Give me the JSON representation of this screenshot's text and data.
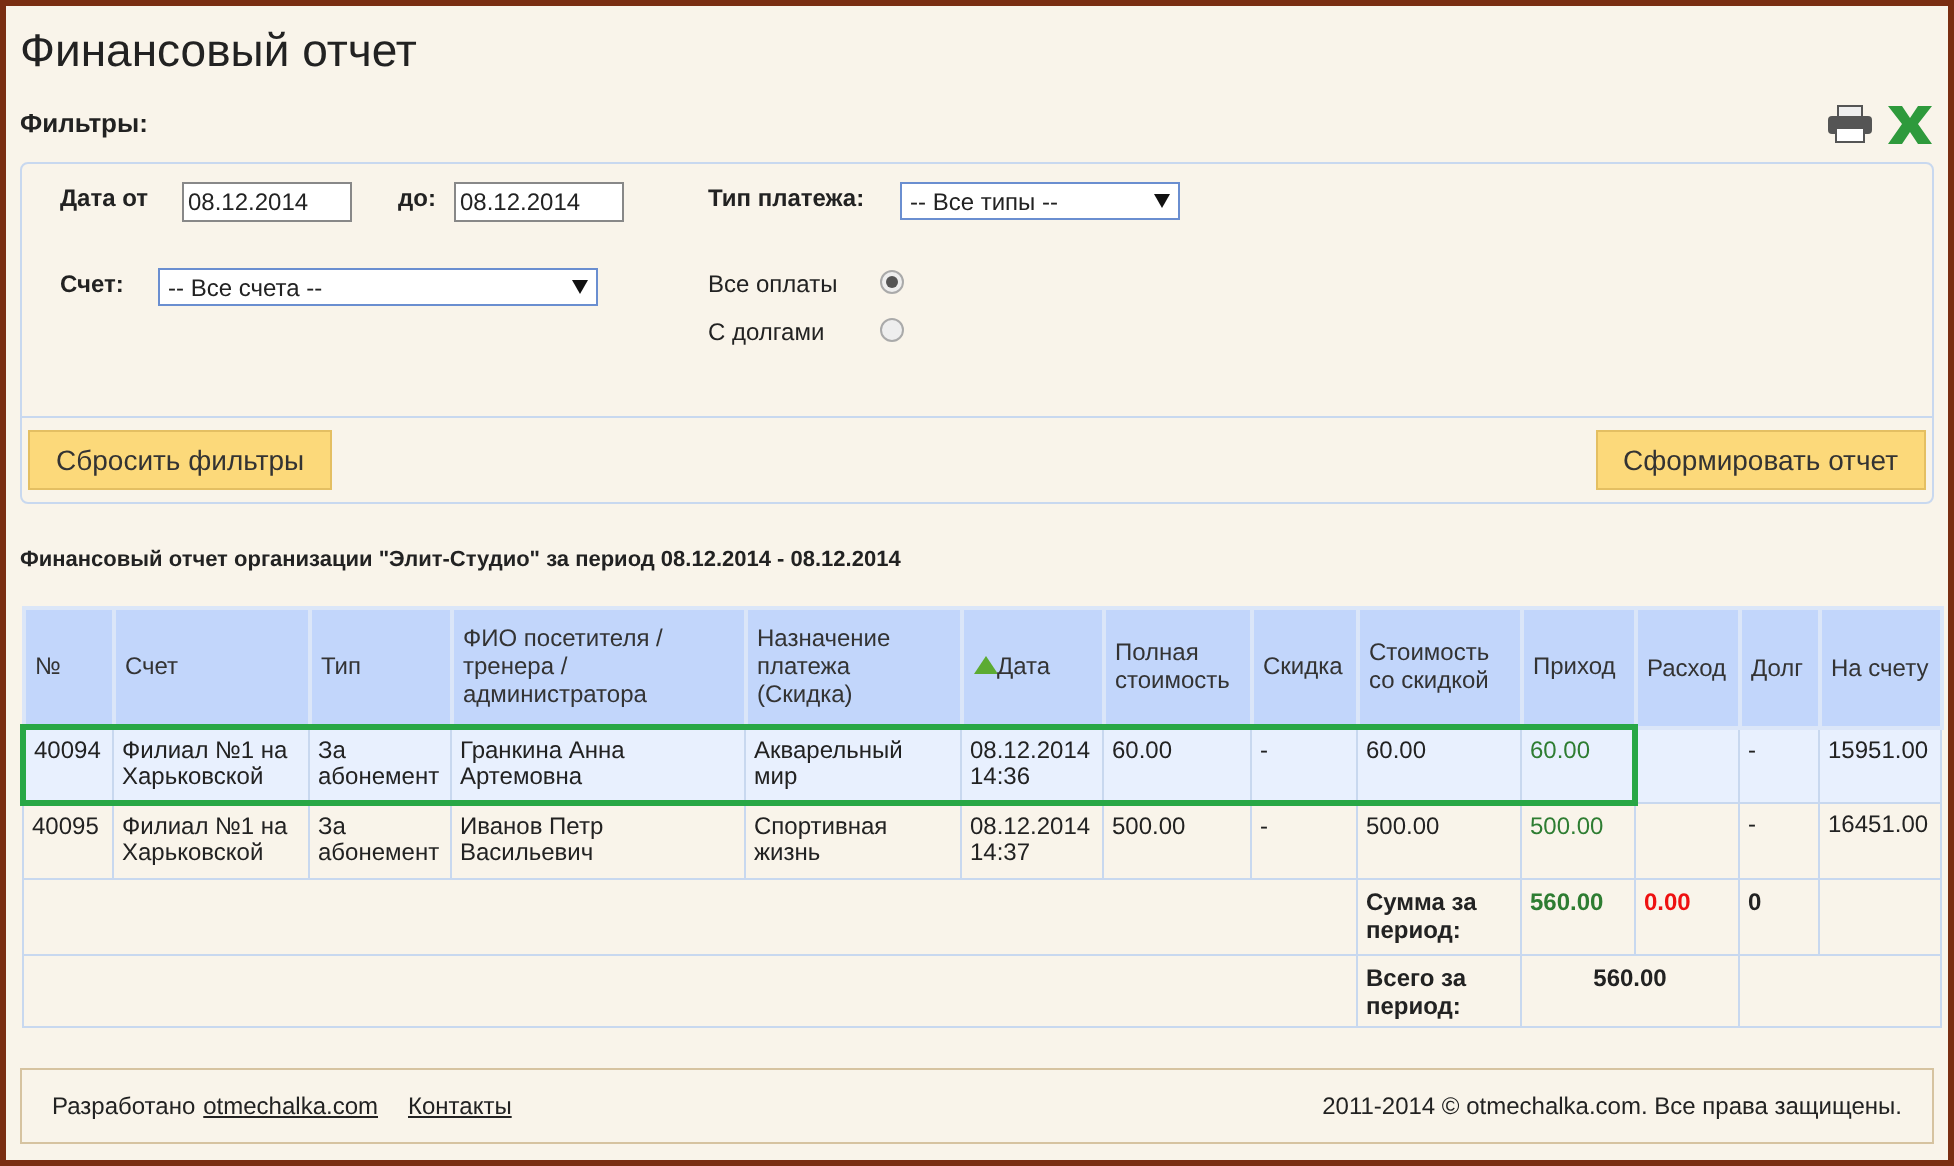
{
  "page_title": "Финансовый отчет",
  "filters": {
    "heading": "Фильтры:",
    "date_from": {
      "label": "Дата от",
      "value": "08.12.2014"
    },
    "date_to": {
      "label": "до:",
      "value": "08.12.2014"
    },
    "payment_type": {
      "label": "Тип платежа:",
      "value": "-- Все типы --"
    },
    "account": {
      "label": "Счет:",
      "value": "-- Все счета --"
    },
    "payment_filter": [
      {
        "label": "Все оплаты",
        "selected": true
      },
      {
        "label": "С долгами",
        "selected": false
      }
    ],
    "reset_button": "Сбросить фильтры",
    "submit_button": "Сформировать отчет"
  },
  "report_title": "Финансовый отчет организации \"Элит-Студио\" за период 08.12.2014 - 08.12.2014",
  "table": {
    "columns": [
      {
        "label": "№"
      },
      {
        "label": "Счет"
      },
      {
        "label": "Тип"
      },
      {
        "label": "ФИО посетителя / тренера / администратора"
      },
      {
        "label": "Назначение платежа (Скидка)"
      },
      {
        "label": "Дата",
        "sorted": true
      },
      {
        "label": "Полная стоимость"
      },
      {
        "label": "Скидка"
      },
      {
        "label": "Стоимость со скидкой"
      },
      {
        "label": "Приход"
      },
      {
        "label": "Расход"
      },
      {
        "label": "Долг"
      },
      {
        "label": "На счету"
      }
    ],
    "rows": [
      {
        "selected": true,
        "cells": [
          "40094",
          "Филиал №1 на Харьковской",
          "За абонемент",
          "Гранкина Анна Артемовна",
          "Акварельный мир",
          "08.12.2014 14:36",
          "60.00",
          "-",
          "60.00",
          "60.00",
          "",
          "-",
          "15951.00"
        ]
      },
      {
        "selected": false,
        "cells": [
          "40095",
          "Филиал №1 на Харьковской",
          "За абонемент",
          "Иванов Петр Васильевич",
          "Спортивная жизнь",
          "08.12.2014 14:37",
          "500.00",
          "-",
          "500.00",
          "500.00",
          "",
          "-",
          "16451.00"
        ]
      }
    ],
    "period_sum": {
      "label": "Сумма за период:",
      "income": "560.00",
      "expense": "0.00",
      "debt": "0"
    },
    "period_total": {
      "label": "Всего за период:",
      "value": "560.00"
    }
  },
  "footer": {
    "developed_by": "Разработано",
    "developer_link": "otmechalka.com",
    "contacts_link": "Контакты",
    "copyright": "2011-2014 © otmechalka.com. Все права защищены."
  }
}
